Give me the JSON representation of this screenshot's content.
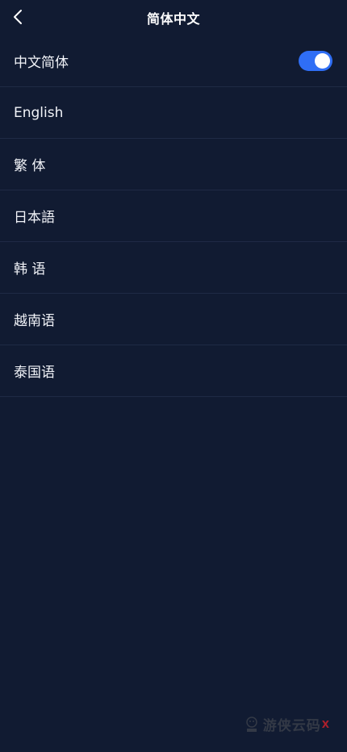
{
  "header": {
    "title": "简体中文",
    "back_icon": "chevron-left-icon"
  },
  "languages": [
    {
      "label": "中文简体",
      "selected": true
    },
    {
      "label": "English",
      "selected": false
    },
    {
      "label": "繁 体",
      "selected": false
    },
    {
      "label": "日本語",
      "selected": false
    },
    {
      "label": "韩 语",
      "selected": false
    },
    {
      "label": "越南语",
      "selected": false
    },
    {
      "label": "泰国语",
      "selected": false
    }
  ],
  "colors": {
    "background": "#111b32",
    "toggle_on": "#2f6ef5",
    "divider": "#1f2a45"
  },
  "watermark": {
    "text": "游侠云码",
    "mark": "X"
  }
}
